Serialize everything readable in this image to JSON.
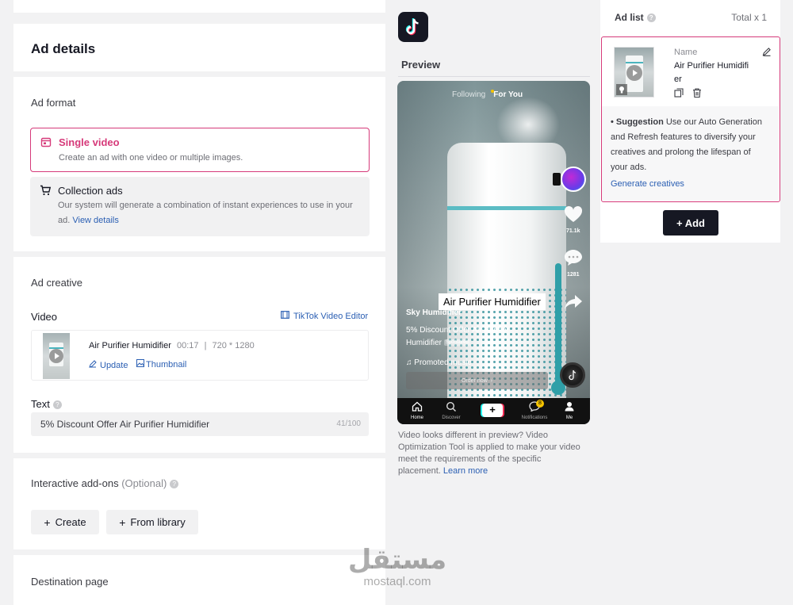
{
  "ad_details": {
    "title": "Ad details",
    "ad_format_heading": "Ad format",
    "formats": [
      {
        "title": "Single video",
        "desc": "Create an ad with one video or multiple images."
      },
      {
        "title": "Collection ads",
        "desc_line1": "Our system will generate a combination of instant experiences to use in your",
        "desc_line2_prefix": "ad.",
        "desc_link": "View details"
      }
    ],
    "ad_creative_heading": "Ad creative",
    "video_label": "Video",
    "video_editor_link": "TikTok Video Editor",
    "video_item": {
      "name": "Air Purifier Humidifier",
      "duration": "00:17",
      "separator": "|",
      "resolution": "720 * 1280",
      "update": "Update",
      "thumbnail": "Thumbnail"
    },
    "text_label": "Text",
    "text_value": "5% Discount Offer Air Purifier Humidifier",
    "text_count": "41/100",
    "interactive_label": "Interactive add-ons",
    "interactive_optional": "(Optional)",
    "create_btn": "Create",
    "library_btn": "From library",
    "destination_label": "Destination page"
  },
  "preview": {
    "label": "Preview",
    "tabs": {
      "following": "Following",
      "for_you": "For You"
    },
    "likes": "71.1k",
    "comments": "1281",
    "overlay_title": "Air Purifier Humidifier",
    "account": "Sky Humidifier",
    "caption_line1": "5% Discount Offer Air Purifier",
    "caption_line2": "Humidifier",
    "sponsored": "Sponsored",
    "music": "Promoted music",
    "cta": "Order now",
    "nav": [
      "Home",
      "Discover",
      "+",
      "Notifications",
      "Me"
    ],
    "notification_badge": "8",
    "note": [
      "Video looks different in preview? Video",
      "Optimization Tool is applied to make your video",
      "meet the requirements of the specific",
      "placement."
    ],
    "note_link": "Learn more"
  },
  "ad_list": {
    "title": "Ad list",
    "total": "Total x 1",
    "item_name_label": "Name",
    "item_name_line1": "Air Purifier Humidifi",
    "item_name_line2": "er",
    "suggestion_label": "• Suggestion",
    "suggestion_lines": [
      "Use our Auto Generation",
      "and Refresh features to diversify your",
      "creatives and prolong the lifespan of",
      "your ads."
    ],
    "generate_link": "Generate creatives",
    "add_btn": "+ Add"
  },
  "watermark": {
    "arabic": "مستقل",
    "latin": "mostaql.com"
  },
  "colors": {
    "accent": "#d63a7a",
    "link": "#2b5fb3",
    "dark": "#161823"
  }
}
